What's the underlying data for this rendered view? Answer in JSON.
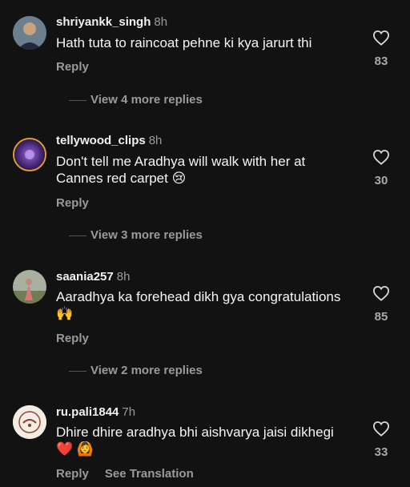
{
  "comments": [
    {
      "username": "shriyankk_singh",
      "time": "8h",
      "text": "Hath tuta to raincoat pehne ki kya jarurt thi",
      "reply": "Reply",
      "likes": "83",
      "more_replies": "View 4 more replies"
    },
    {
      "username": "tellywood_clips",
      "time": "8h",
      "text": "Don't tell me Aradhya will walk with her at Cannes red carpet 😢",
      "reply": "Reply",
      "likes": "30",
      "more_replies": "View 3 more replies"
    },
    {
      "username": "saania257",
      "time": "8h",
      "text": "Aaradhya ka forehead dikh gya congratulations 🙌",
      "reply": "Reply",
      "likes": "85",
      "more_replies": "View 2 more replies"
    },
    {
      "username": "ru.pali1844",
      "time": "7h",
      "text": "Dhire dhire aradhya bhi aishvarya jaisi dikhegi ❤️ 🙆",
      "reply": "Reply",
      "see_translation": "See Translation",
      "likes": "33"
    }
  ],
  "icons": {
    "like": "heart-outline-icon"
  },
  "colors": {
    "background": "#121212",
    "secondary_text": "#9a9a9a"
  }
}
